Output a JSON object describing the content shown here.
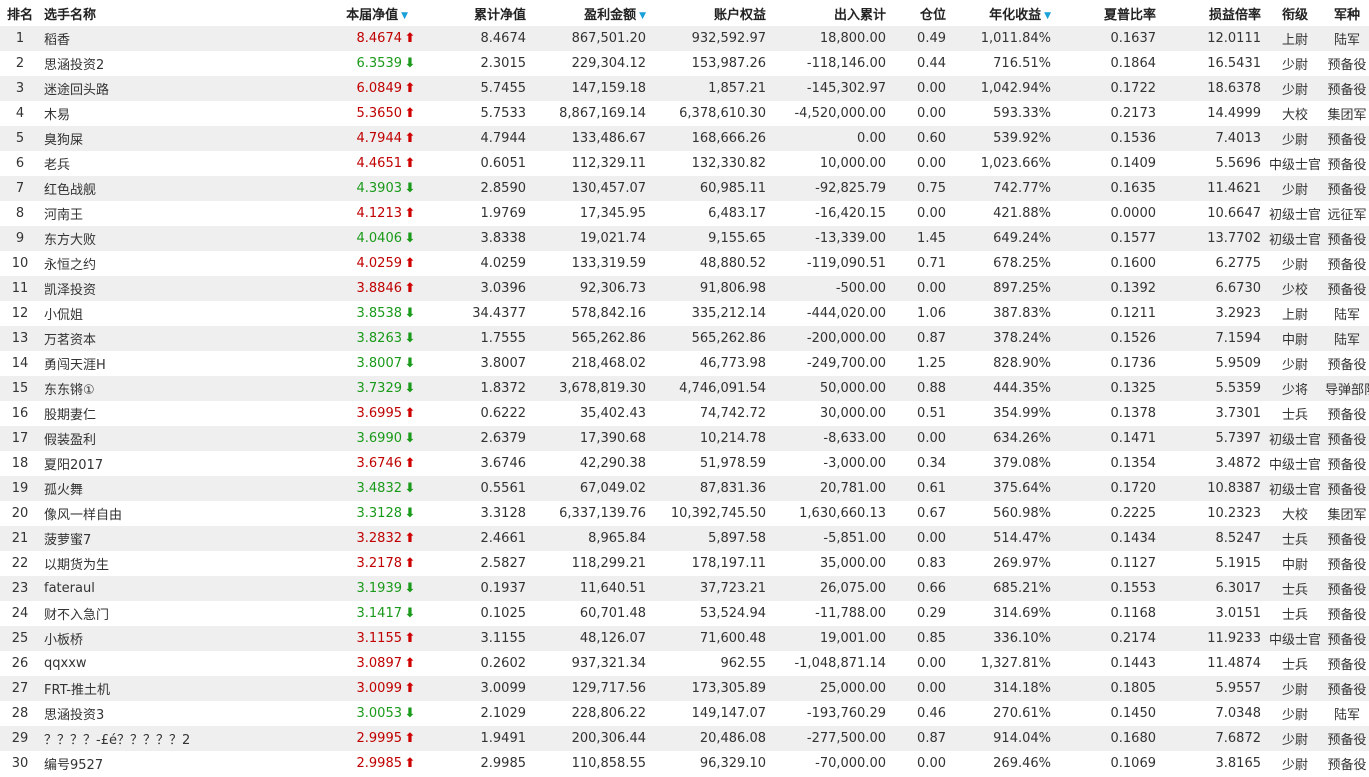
{
  "colors": {
    "up": "#c00000",
    "down": "#1a9a1a",
    "sort_indicator": "#1aa0d8",
    "row_stripe": "#efefef"
  },
  "icons": {
    "sort": "sort-down-triangle-icon",
    "up": "red-up-arrow-icon",
    "down": "green-down-arrow-icon"
  },
  "columns": {
    "rank": "排名",
    "name": "选手名称",
    "weekly_nav": "本届净值",
    "cum_nav": "累计净值",
    "profit": "盈利金额",
    "equity": "账户权益",
    "flow": "出入累计",
    "position": "仓位",
    "annual": "年化收益",
    "sharpe": "夏普比率",
    "pl_ratio": "损益倍率",
    "rank_title": "衔级",
    "branch": "军种"
  },
  "sorted_columns": [
    "weekly_nav",
    "profit",
    "annual"
  ],
  "rows": [
    {
      "rank": "1",
      "name": "稻香",
      "weekly_nav": "8.4674",
      "trend": "up",
      "cum_nav": "8.4674",
      "profit": "867,501.20",
      "equity": "932,592.97",
      "flow": "18,800.00",
      "position": "0.49",
      "annual": "1,011.84%",
      "sharpe": "0.1637",
      "pl_ratio": "12.0111",
      "rank_title": "上尉",
      "branch": "陆军"
    },
    {
      "rank": "2",
      "name": "思涵投资2",
      "weekly_nav": "6.3539",
      "trend": "down",
      "cum_nav": "2.3015",
      "profit": "229,304.12",
      "equity": "153,987.26",
      "flow": "-118,146.00",
      "position": "0.44",
      "annual": "716.51%",
      "sharpe": "0.1864",
      "pl_ratio": "16.5431",
      "rank_title": "少尉",
      "branch": "预备役"
    },
    {
      "rank": "3",
      "name": "迷途回头路",
      "weekly_nav": "6.0849",
      "trend": "up",
      "cum_nav": "5.7455",
      "profit": "147,159.18",
      "equity": "1,857.21",
      "flow": "-145,302.97",
      "position": "0.00",
      "annual": "1,042.94%",
      "sharpe": "0.1722",
      "pl_ratio": "18.6378",
      "rank_title": "少尉",
      "branch": "预备役"
    },
    {
      "rank": "4",
      "name": "木易",
      "weekly_nav": "5.3650",
      "trend": "up",
      "cum_nav": "5.7533",
      "profit": "8,867,169.14",
      "equity": "6,378,610.30",
      "flow": "-4,520,000.00",
      "position": "0.00",
      "annual": "593.33%",
      "sharpe": "0.2173",
      "pl_ratio": "14.4999",
      "rank_title": "大校",
      "branch": "集团军"
    },
    {
      "rank": "5",
      "name": "臭狗屎",
      "weekly_nav": "4.7944",
      "trend": "up",
      "cum_nav": "4.7944",
      "profit": "133,486.67",
      "equity": "168,666.26",
      "flow": "0.00",
      "position": "0.60",
      "annual": "539.92%",
      "sharpe": "0.1536",
      "pl_ratio": "7.4013",
      "rank_title": "少尉",
      "branch": "预备役"
    },
    {
      "rank": "6",
      "name": "老兵",
      "weekly_nav": "4.4651",
      "trend": "up",
      "cum_nav": "0.6051",
      "profit": "112,329.11",
      "equity": "132,330.82",
      "flow": "10,000.00",
      "position": "0.00",
      "annual": "1,023.66%",
      "sharpe": "0.1409",
      "pl_ratio": "5.5696",
      "rank_title": "中级士官",
      "branch": "预备役"
    },
    {
      "rank": "7",
      "name": "红色战舰",
      "weekly_nav": "4.3903",
      "trend": "down",
      "cum_nav": "2.8590",
      "profit": "130,457.07",
      "equity": "60,985.11",
      "flow": "-92,825.79",
      "position": "0.75",
      "annual": "742.77%",
      "sharpe": "0.1635",
      "pl_ratio": "11.4621",
      "rank_title": "少尉",
      "branch": "预备役"
    },
    {
      "rank": "8",
      "name": "河南王",
      "weekly_nav": "4.1213",
      "trend": "up",
      "cum_nav": "1.9769",
      "profit": "17,345.95",
      "equity": "6,483.17",
      "flow": "-16,420.15",
      "position": "0.00",
      "annual": "421.88%",
      "sharpe": "0.0000",
      "pl_ratio": "10.6647",
      "rank_title": "初级士官",
      "branch": "远征军"
    },
    {
      "rank": "9",
      "name": "东方大败",
      "weekly_nav": "4.0406",
      "trend": "down",
      "cum_nav": "3.8338",
      "profit": "19,021.74",
      "equity": "9,155.65",
      "flow": "-13,339.00",
      "position": "1.45",
      "annual": "649.24%",
      "sharpe": "0.1577",
      "pl_ratio": "13.7702",
      "rank_title": "初级士官",
      "branch": "预备役"
    },
    {
      "rank": "10",
      "name": "永恒之约",
      "weekly_nav": "4.0259",
      "trend": "up",
      "cum_nav": "4.0259",
      "profit": "133,319.59",
      "equity": "48,880.52",
      "flow": "-119,090.51",
      "position": "0.71",
      "annual": "678.25%",
      "sharpe": "0.1600",
      "pl_ratio": "6.2775",
      "rank_title": "少尉",
      "branch": "预备役"
    },
    {
      "rank": "11",
      "name": "凯泽投资",
      "weekly_nav": "3.8846",
      "trend": "up",
      "cum_nav": "3.0396",
      "profit": "92,306.73",
      "equity": "91,806.98",
      "flow": "-500.00",
      "position": "0.00",
      "annual": "897.25%",
      "sharpe": "0.1392",
      "pl_ratio": "6.6730",
      "rank_title": "少校",
      "branch": "预备役"
    },
    {
      "rank": "12",
      "name": "小侃姐",
      "weekly_nav": "3.8538",
      "trend": "down",
      "cum_nav": "34.4377",
      "profit": "578,842.16",
      "equity": "335,212.14",
      "flow": "-444,020.00",
      "position": "1.06",
      "annual": "387.83%",
      "sharpe": "0.1211",
      "pl_ratio": "3.2923",
      "rank_title": "上尉",
      "branch": "陆军"
    },
    {
      "rank": "13",
      "name": "万茗资本",
      "weekly_nav": "3.8263",
      "trend": "down",
      "cum_nav": "1.7555",
      "profit": "565,262.86",
      "equity": "565,262.86",
      "flow": "-200,000.00",
      "position": "0.87",
      "annual": "378.24%",
      "sharpe": "0.1526",
      "pl_ratio": "7.1594",
      "rank_title": "中尉",
      "branch": "陆军"
    },
    {
      "rank": "14",
      "name": "勇闯天涯H",
      "weekly_nav": "3.8007",
      "trend": "down",
      "cum_nav": "3.8007",
      "profit": "218,468.02",
      "equity": "46,773.98",
      "flow": "-249,700.00",
      "position": "1.25",
      "annual": "828.90%",
      "sharpe": "0.1736",
      "pl_ratio": "5.9509",
      "rank_title": "少尉",
      "branch": "预备役"
    },
    {
      "rank": "15",
      "name": "东东锵①",
      "weekly_nav": "3.7329",
      "trend": "down",
      "cum_nav": "1.8372",
      "profit": "3,678,819.30",
      "equity": "4,746,091.54",
      "flow": "50,000.00",
      "position": "0.88",
      "annual": "444.35%",
      "sharpe": "0.1325",
      "pl_ratio": "5.5359",
      "rank_title": "少将",
      "branch": "导弹部队"
    },
    {
      "rank": "16",
      "name": "股期妻仁",
      "weekly_nav": "3.6995",
      "trend": "up",
      "cum_nav": "0.6222",
      "profit": "35,402.43",
      "equity": "74,742.72",
      "flow": "30,000.00",
      "position": "0.51",
      "annual": "354.99%",
      "sharpe": "0.1378",
      "pl_ratio": "3.7301",
      "rank_title": "士兵",
      "branch": "预备役"
    },
    {
      "rank": "17",
      "name": "假装盈利",
      "weekly_nav": "3.6990",
      "trend": "down",
      "cum_nav": "2.6379",
      "profit": "17,390.68",
      "equity": "10,214.78",
      "flow": "-8,633.00",
      "position": "0.00",
      "annual": "634.26%",
      "sharpe": "0.1471",
      "pl_ratio": "5.7397",
      "rank_title": "初级士官",
      "branch": "预备役"
    },
    {
      "rank": "18",
      "name": "夏阳2017",
      "weekly_nav": "3.6746",
      "trend": "up",
      "cum_nav": "3.6746",
      "profit": "42,290.38",
      "equity": "51,978.59",
      "flow": "-3,000.00",
      "position": "0.34",
      "annual": "379.08%",
      "sharpe": "0.1354",
      "pl_ratio": "3.4872",
      "rank_title": "中级士官",
      "branch": "预备役"
    },
    {
      "rank": "19",
      "name": "孤火舞",
      "weekly_nav": "3.4832",
      "trend": "down",
      "cum_nav": "0.5561",
      "profit": "67,049.02",
      "equity": "87,831.36",
      "flow": "20,781.00",
      "position": "0.61",
      "annual": "375.64%",
      "sharpe": "0.1720",
      "pl_ratio": "10.8387",
      "rank_title": "初级士官",
      "branch": "预备役"
    },
    {
      "rank": "20",
      "name": "像风一样自由",
      "weekly_nav": "3.3128",
      "trend": "down",
      "cum_nav": "3.3128",
      "profit": "6,337,139.76",
      "equity": "10,392,745.50",
      "flow": "1,630,660.13",
      "position": "0.67",
      "annual": "560.98%",
      "sharpe": "0.2225",
      "pl_ratio": "10.2323",
      "rank_title": "大校",
      "branch": "集团军"
    },
    {
      "rank": "21",
      "name": "菠萝蜜7",
      "weekly_nav": "3.2832",
      "trend": "up",
      "cum_nav": "2.4661",
      "profit": "8,965.84",
      "equity": "5,897.58",
      "flow": "-5,851.00",
      "position": "0.00",
      "annual": "514.47%",
      "sharpe": "0.1434",
      "pl_ratio": "8.5247",
      "rank_title": "士兵",
      "branch": "预备役"
    },
    {
      "rank": "22",
      "name": "以期货为生",
      "weekly_nav": "3.2178",
      "trend": "up",
      "cum_nav": "2.5827",
      "profit": "118,299.21",
      "equity": "178,197.11",
      "flow": "35,000.00",
      "position": "0.83",
      "annual": "269.97%",
      "sharpe": "0.1127",
      "pl_ratio": "5.1915",
      "rank_title": "中尉",
      "branch": "预备役"
    },
    {
      "rank": "23",
      "name": "fateraul",
      "weekly_nav": "3.1939",
      "trend": "down",
      "cum_nav": "0.1937",
      "profit": "11,640.51",
      "equity": "37,723.21",
      "flow": "26,075.00",
      "position": "0.66",
      "annual": "685.21%",
      "sharpe": "0.1553",
      "pl_ratio": "6.3017",
      "rank_title": "士兵",
      "branch": "预备役"
    },
    {
      "rank": "24",
      "name": "财不入急门",
      "weekly_nav": "3.1417",
      "trend": "down",
      "cum_nav": "0.1025",
      "profit": "60,701.48",
      "equity": "53,524.94",
      "flow": "-11,788.00",
      "position": "0.29",
      "annual": "314.69%",
      "sharpe": "0.1168",
      "pl_ratio": "3.0151",
      "rank_title": "士兵",
      "branch": "预备役"
    },
    {
      "rank": "25",
      "name": "小板桥",
      "weekly_nav": "3.1155",
      "trend": "up",
      "cum_nav": "3.1155",
      "profit": "48,126.07",
      "equity": "71,600.48",
      "flow": "19,001.00",
      "position": "0.85",
      "annual": "336.10%",
      "sharpe": "0.2174",
      "pl_ratio": "11.9233",
      "rank_title": "中级士官",
      "branch": "预备役"
    },
    {
      "rank": "26",
      "name": "qqxxw",
      "weekly_nav": "3.0897",
      "trend": "up",
      "cum_nav": "0.2602",
      "profit": "937,321.34",
      "equity": "962.55",
      "flow": "-1,048,871.14",
      "position": "0.00",
      "annual": "1,327.81%",
      "sharpe": "0.1443",
      "pl_ratio": "11.4874",
      "rank_title": "士兵",
      "branch": "预备役"
    },
    {
      "rank": "27",
      "name": "FRT-推土机",
      "weekly_nav": "3.0099",
      "trend": "up",
      "cum_nav": "3.0099",
      "profit": "129,717.56",
      "equity": "173,305.89",
      "flow": "25,000.00",
      "position": "0.00",
      "annual": "314.18%",
      "sharpe": "0.1805",
      "pl_ratio": "5.9557",
      "rank_title": "少尉",
      "branch": "预备役"
    },
    {
      "rank": "28",
      "name": "思涵投资3",
      "weekly_nav": "3.0053",
      "trend": "down",
      "cum_nav": "2.1029",
      "profit": "228,806.22",
      "equity": "149,147.07",
      "flow": "-193,760.29",
      "position": "0.46",
      "annual": "270.61%",
      "sharpe": "0.1450",
      "pl_ratio": "7.0348",
      "rank_title": "少尉",
      "branch": "陆军"
    },
    {
      "rank": "29",
      "name": "？？？？-£é？？？？？2",
      "weekly_nav": "2.9995",
      "trend": "up",
      "cum_nav": "1.9491",
      "profit": "200,306.44",
      "equity": "20,486.08",
      "flow": "-277,500.00",
      "position": "0.87",
      "annual": "914.04%",
      "sharpe": "0.1680",
      "pl_ratio": "7.6872",
      "rank_title": "少尉",
      "branch": "预备役"
    },
    {
      "rank": "30",
      "name": "编号9527",
      "weekly_nav": "2.9985",
      "trend": "up",
      "cum_nav": "2.9985",
      "profit": "110,858.55",
      "equity": "96,329.10",
      "flow": "-70,000.00",
      "position": "0.00",
      "annual": "269.46%",
      "sharpe": "0.1069",
      "pl_ratio": "3.8165",
      "rank_title": "少尉",
      "branch": "预备役"
    }
  ]
}
